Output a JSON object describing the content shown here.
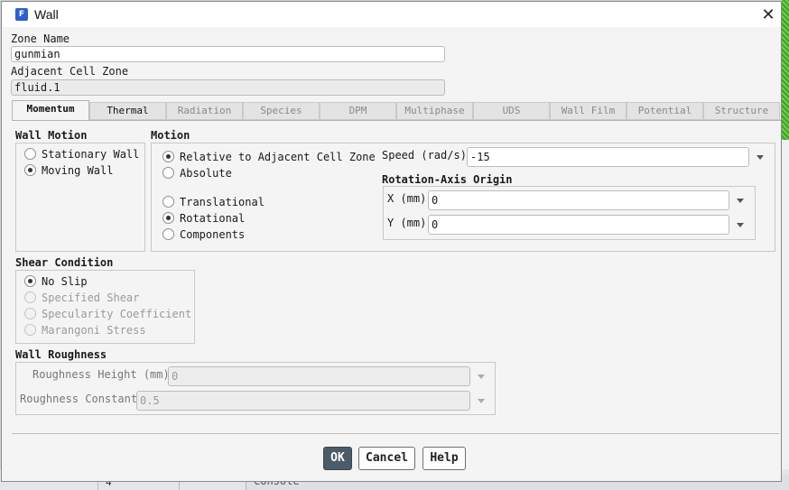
{
  "dialog": {
    "title": "Wall",
    "app_icon_letter": "F",
    "close_symbol": "✕"
  },
  "zone": {
    "name_label": "Zone Name",
    "name_value": "gunmian",
    "adjacent_label": "Adjacent Cell Zone",
    "adjacent_value": "fluid.1"
  },
  "tabs": [
    "Momentum",
    "Thermal",
    "Radiation",
    "Species",
    "DPM",
    "Multiphase",
    "UDS",
    "Wall Film",
    "Potential",
    "Structure"
  ],
  "wall_motion": {
    "title": "Wall Motion",
    "options": [
      "Stationary Wall",
      "Moving Wall"
    ],
    "selected": "Moving Wall"
  },
  "motion": {
    "title": "Motion",
    "reference_options": [
      "Relative to Adjacent Cell Zone",
      "Absolute"
    ],
    "reference_selected": "Relative to Adjacent Cell Zone",
    "type_options": [
      "Translational",
      "Rotational",
      "Components"
    ],
    "type_selected": "Rotational",
    "speed_label": "Speed (rad/s)",
    "speed_value": "-15",
    "origin_title": "Rotation-Axis Origin",
    "x_label": "X (mm)",
    "x_value": "0",
    "y_label": "Y (mm)",
    "y_value": "0"
  },
  "shear": {
    "title": "Shear Condition",
    "options": [
      "No Slip",
      "Specified Shear",
      "Specularity Coefficient",
      "Marangoni Stress"
    ],
    "selected": "No Slip"
  },
  "roughness": {
    "title": "Wall Roughness",
    "height_label": "Roughness Height (mm)",
    "height_value": "0",
    "constant_label": "Roughness Constant",
    "constant_value": "0.5"
  },
  "buttons": {
    "ok": "OK",
    "cancel": "Cancel",
    "help": "Help"
  },
  "background": {
    "cell_value": "4",
    "console_label": "Console"
  }
}
